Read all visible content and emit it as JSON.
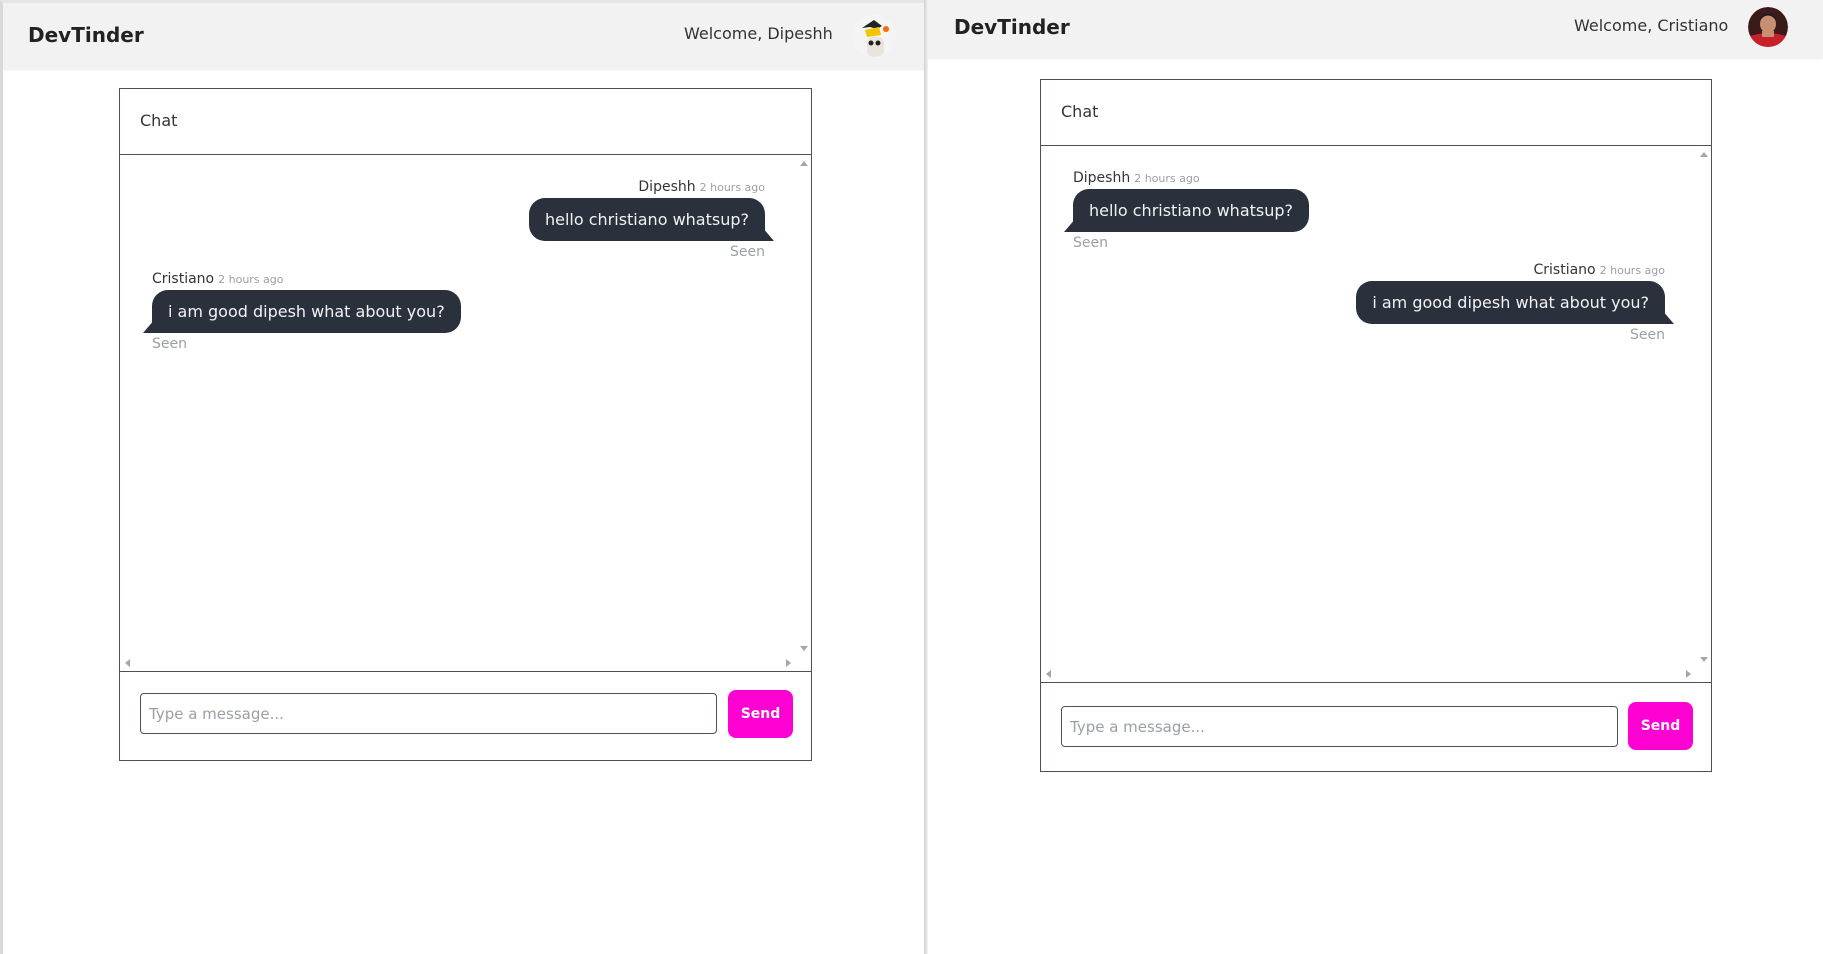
{
  "brand_color": "#ff00d3",
  "bubble_color": "#2a303c",
  "left": {
    "navbar": {
      "brand": "DevTinder",
      "welcome": "Welcome, Dipeshh",
      "avatar": "user-avatar"
    },
    "chat": {
      "title": "Chat",
      "messages": [
        {
          "sender": "Dipeshh",
          "time": "2 hours ago",
          "text": "hello christiano whatsup?",
          "status": "Seen"
        },
        {
          "sender": "Cristiano",
          "time": "2 hours ago",
          "text": "i am good dipesh what about you?",
          "status": "Seen"
        }
      ],
      "input_placeholder": "Type a message...",
      "send_label": "Send"
    }
  },
  "right": {
    "navbar": {
      "brand": "DevTinder",
      "welcome": "Welcome, Cristiano",
      "avatar": "user-avatar"
    },
    "chat": {
      "title": "Chat",
      "messages": [
        {
          "sender": "Dipeshh",
          "time": "2 hours ago",
          "text": "hello christiano whatsup?",
          "status": "Seen"
        },
        {
          "sender": "Cristiano",
          "time": "2 hours ago",
          "text": "i am good dipesh what about you?",
          "status": "Seen"
        }
      ],
      "input_placeholder": "Type a message...",
      "send_label": "Send"
    }
  }
}
